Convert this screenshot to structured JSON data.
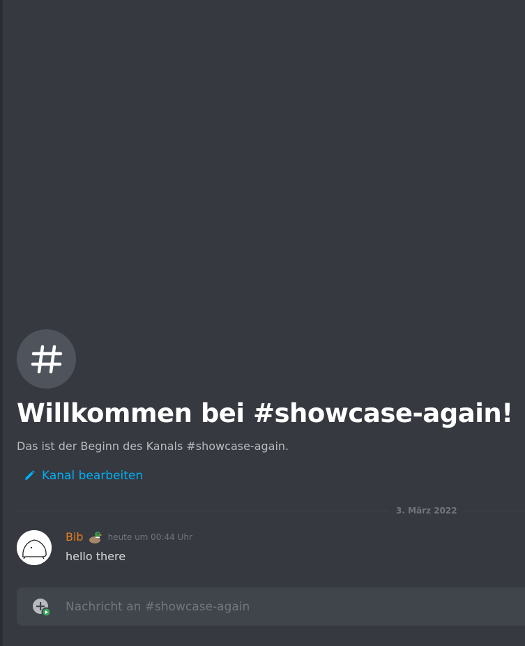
{
  "channel": {
    "welcome_title": "Willkommen bei #showcase-again!",
    "welcome_subtitle": "Das ist der Beginn des Kanals #showcase-again.",
    "edit_label": "Kanal bearbeiten",
    "icon": "hash-icon"
  },
  "divider": {
    "date": "3. März 2022"
  },
  "message": {
    "author": "Bib",
    "author_color": "#e67e22",
    "author_emoji": "duck-emoji",
    "timestamp": "heute um 00:44 Uhr",
    "text": "hello there",
    "avatar": "avatar-image"
  },
  "composer": {
    "placeholder": "Nachricht an #showcase-again",
    "add_icon": "add-attachment-icon"
  },
  "colors": {
    "background": "#36393f",
    "link": "#00aff4",
    "composer_bg": "#40444b"
  }
}
